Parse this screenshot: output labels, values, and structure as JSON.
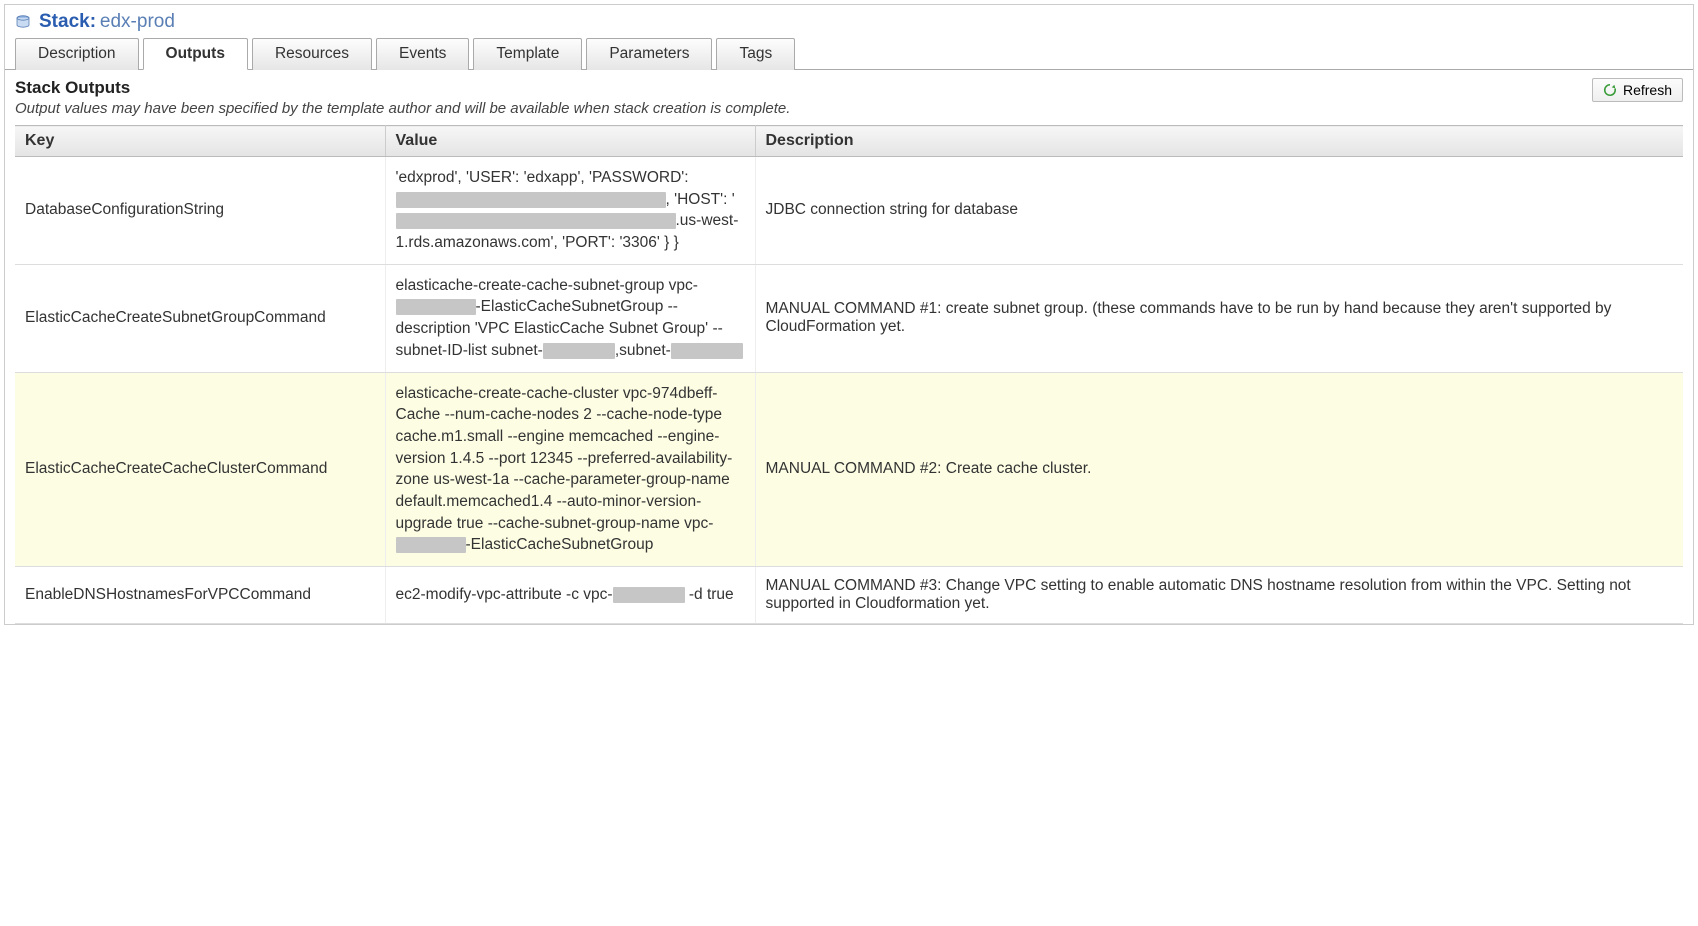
{
  "header": {
    "stack_label": "Stack:",
    "stack_name": "edx-prod"
  },
  "tabs": [
    {
      "label": "Description",
      "active": false
    },
    {
      "label": "Outputs",
      "active": true
    },
    {
      "label": "Resources",
      "active": false
    },
    {
      "label": "Events",
      "active": false
    },
    {
      "label": "Template",
      "active": false
    },
    {
      "label": "Parameters",
      "active": false
    },
    {
      "label": "Tags",
      "active": false
    }
  ],
  "section": {
    "title": "Stack Outputs",
    "subtitle": "Output values may have been specified by the template author and will be available when stack creation is complete.",
    "refresh_label": "Refresh"
  },
  "columns": {
    "key": "Key",
    "value": "Value",
    "description": "Description"
  },
  "rows": [
    {
      "key": "DatabaseConfigurationString",
      "value_segments": [
        {
          "text": "'edxprod', 'USER': 'edxapp', 'PASSWORD': "
        },
        {
          "redact": "w1"
        },
        {
          "text": ", 'HOST': '"
        },
        {
          "redact": "w2"
        },
        {
          "text": ".us-west-1.rds.amazonaws.com', 'PORT': '3306' } }"
        }
      ],
      "description": "JDBC connection string for database",
      "highlight": false,
      "value_clip_top": true
    },
    {
      "key": "ElasticCacheCreateSubnetGroupCommand",
      "value_segments": [
        {
          "text": "elasticache-create-cache-subnet-group vpc-"
        },
        {
          "redact": "w3"
        },
        {
          "text": "-ElasticCacheSubnetGroup --description 'VPC ElasticCache Subnet Group' --subnet-ID-list subnet-"
        },
        {
          "redact": "w4"
        },
        {
          "text": ",subnet-"
        },
        {
          "redact": "w5"
        }
      ],
      "description": "MANUAL COMMAND #1: create subnet group. (these commands have to be run by hand because they aren't supported by CloudFormation yet.",
      "highlight": false
    },
    {
      "key": "ElasticCacheCreateCacheClusterCommand",
      "value_segments": [
        {
          "text": "elasticache-create-cache-cluster vpc-974dbeff-Cache --num-cache-nodes 2 --cache-node-type cache.m1.small --engine memcached --engine-version 1.4.5 --port 12345 --preferred-availability-zone us-west-1a --cache-parameter-group-name default.memcached1.4 --auto-minor-version-upgrade true --cache-subnet-group-name vpc-"
        },
        {
          "redact": "w6"
        },
        {
          "text": "-ElasticCacheSubnetGroup"
        }
      ],
      "description": "MANUAL COMMAND #2: Create cache cluster.",
      "highlight": true
    },
    {
      "key": "EnableDNSHostnamesForVPCCommand",
      "value_segments": [
        {
          "text": "ec2-modify-vpc-attribute -c vpc-"
        },
        {
          "redact": "w7"
        },
        {
          "text": " -d true"
        }
      ],
      "description": "MANUAL COMMAND #3: Change VPC setting to enable automatic DNS hostname resolution from within the VPC. Setting not supported in Cloudformation yet.",
      "highlight": false
    }
  ]
}
